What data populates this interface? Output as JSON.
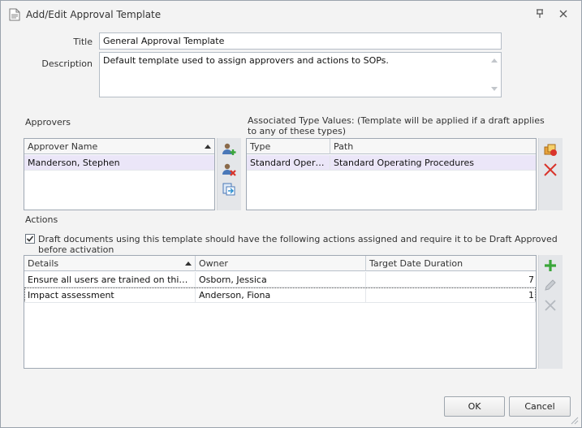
{
  "window": {
    "title": "Add/Edit Approval Template",
    "icons": [
      "document-icon",
      "pin-icon",
      "close-icon"
    ]
  },
  "form": {
    "title_label": "Title",
    "title_value": "General Approval Template",
    "description_label": "Description",
    "description_value": "Default template used to assign approvers and actions to SOPs."
  },
  "approvers": {
    "label": "Approvers",
    "columns": [
      "Approver Name"
    ],
    "rows": [
      {
        "name": "Manderson, Stephen"
      }
    ],
    "tools": [
      "add-approver-icon",
      "remove-approver-icon",
      "import-approvers-icon"
    ]
  },
  "associated": {
    "label": "Associated Type Values: (Template will be applied if a draft applies to any of these types)",
    "columns": [
      "Type",
      "Path"
    ],
    "rows": [
      {
        "type": "Standard Operat...",
        "path": "Standard Operating Procedures"
      }
    ],
    "tools": [
      "add-type-icon",
      "remove-type-icon"
    ]
  },
  "actions": {
    "label": "Actions",
    "checkbox_label": "Draft documents using this template should have the following actions assigned and require it to be Draft Approved before activation",
    "checkbox_checked": true,
    "columns": [
      "Details",
      "Owner",
      "Target Date Duration"
    ],
    "rows": [
      {
        "details": "Ensure all users are trained on this dra...",
        "owner": "Osborn, Jessica",
        "duration": "7"
      },
      {
        "details": "Impact assessment",
        "owner": "Anderson, Fiona",
        "duration": "1"
      }
    ],
    "tools": [
      "add-action-icon",
      "edit-action-icon",
      "delete-action-icon"
    ]
  },
  "buttons": {
    "ok": "OK",
    "cancel": "Cancel"
  },
  "colors": {
    "selection": "#ebe6f8",
    "add_green": "#3aa63a",
    "delete_red": "#d9342b"
  }
}
